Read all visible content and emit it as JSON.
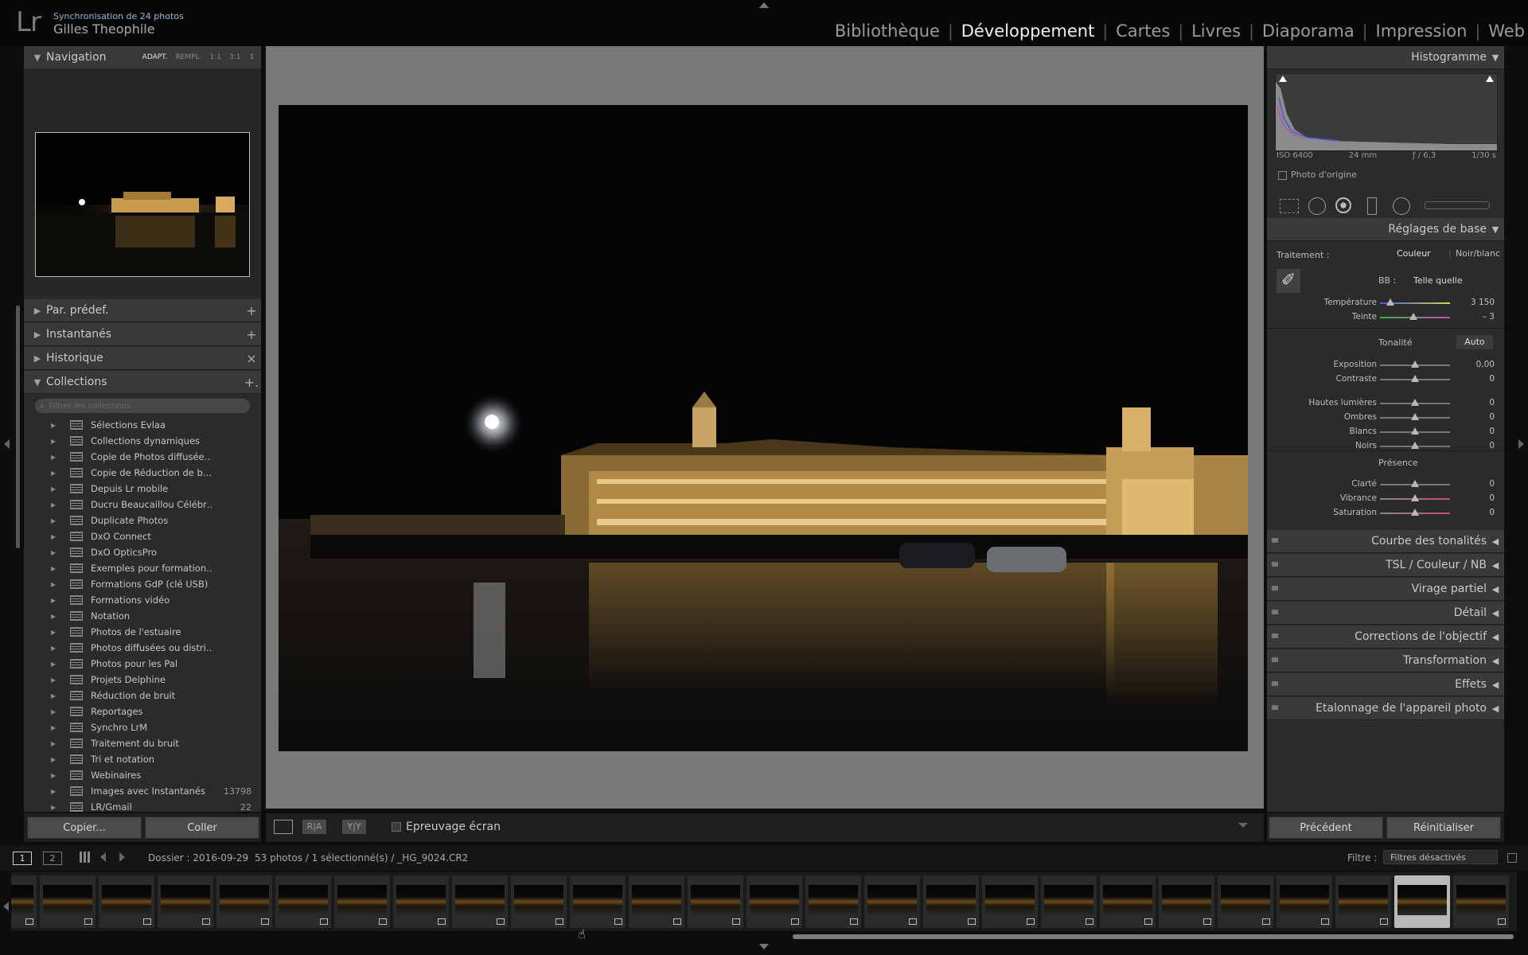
{
  "header": {
    "sync_text": "Synchronisation de 24 photos",
    "user_name": "Gilles Theophile",
    "logo": "Lr",
    "modules": [
      "Bibliothèque",
      "Développement",
      "Cartes",
      "Livres",
      "Diaporama",
      "Impression",
      "Web"
    ],
    "active_module": "Développement"
  },
  "left_panel": {
    "navigation": {
      "title": "Navigation",
      "zoom_options": [
        "ADAPT.",
        "REMPL.",
        "1:1",
        "3:1"
      ],
      "active_zoom": "ADAPT."
    },
    "sections": [
      {
        "title": "Par. prédef.",
        "action": "+"
      },
      {
        "title": "Instantanés",
        "action": "+"
      },
      {
        "title": "Historique",
        "action": "×"
      }
    ],
    "collections": {
      "title": "Collections",
      "action": "+.",
      "search_placeholder": "Filtrer les collections",
      "items": [
        {
          "label": "Sélections Evlaa",
          "count": ""
        },
        {
          "label": "Collections dynamiques",
          "count": ""
        },
        {
          "label": "Copie de Photos diffusée…",
          "count": ""
        },
        {
          "label": "Copie de Réduction de b…",
          "count": ""
        },
        {
          "label": "Depuis Lr mobile",
          "count": ""
        },
        {
          "label": "Ducru Beaucaillou Célébr…",
          "count": ""
        },
        {
          "label": "Duplicate Photos",
          "count": ""
        },
        {
          "label": "DxO Connect",
          "count": ""
        },
        {
          "label": "DxO OpticsPro",
          "count": ""
        },
        {
          "label": "Exemples pour formation…",
          "count": ""
        },
        {
          "label": "Formations GdP (clé USB)",
          "count": ""
        },
        {
          "label": "Formations vidéo",
          "count": ""
        },
        {
          "label": "Notation",
          "count": ""
        },
        {
          "label": "Photos de l'estuaire",
          "count": ""
        },
        {
          "label": "Photos diffusées ou distri…",
          "count": ""
        },
        {
          "label": "Photos pour les Pal",
          "count": ""
        },
        {
          "label": "Projets Delphine",
          "count": ""
        },
        {
          "label": "Réduction de bruit",
          "count": ""
        },
        {
          "label": "Reportages",
          "count": ""
        },
        {
          "label": "Synchro LrM",
          "count": ""
        },
        {
          "label": "Traitement du bruit",
          "count": ""
        },
        {
          "label": "Tri et notation",
          "count": ""
        },
        {
          "label": "Webinaires",
          "count": ""
        },
        {
          "label": "Images avec Instantanés",
          "count": "13798"
        },
        {
          "label": "LR/Gmail",
          "count": "22"
        }
      ]
    },
    "buttons": {
      "copy": "Copier...",
      "paste": "Coller"
    }
  },
  "center": {
    "toolbar": {
      "proof_label": "Epreuvage écran",
      "view_labels": [
        "R|A",
        "Y|Y"
      ]
    }
  },
  "right_panel": {
    "histogram": {
      "title": "Histogramme",
      "iso": "ISO 6400",
      "focal": "24 mm",
      "aperture": "ƒ / 6,3",
      "shutter": "1/30 s",
      "original_photo": "Photo d'origine"
    },
    "basic": {
      "title": "Réglages de base",
      "treatment_label": "Traitement :",
      "treatment_options": [
        "Couleur",
        "Noir/blanc"
      ],
      "wb_label": "BB :",
      "wb_value": "Telle quelle",
      "tone_label": "Tonalité",
      "auto_label": "Auto",
      "presence_label": "Présence",
      "sliders": [
        {
          "label": "Température",
          "value": "3 150",
          "pos": 0.15
        },
        {
          "label": "Teinte",
          "value": "– 3",
          "pos": 0.48
        },
        {
          "label": "Exposition",
          "value": "0,00",
          "pos": 0.5
        },
        {
          "label": "Contraste",
          "value": "0",
          "pos": 0.5
        },
        {
          "label": "Hautes lumières",
          "value": "0",
          "pos": 0.5
        },
        {
          "label": "Ombres",
          "value": "0",
          "pos": 0.5
        },
        {
          "label": "Blancs",
          "value": "0",
          "pos": 0.5
        },
        {
          "label": "Noirs",
          "value": "0",
          "pos": 0.5
        },
        {
          "label": "Clarté",
          "value": "0",
          "pos": 0.5
        },
        {
          "label": "Vibrance",
          "value": "0",
          "pos": 0.5
        },
        {
          "label": "Saturation",
          "value": "0",
          "pos": 0.5
        }
      ]
    },
    "panels": [
      "Courbe des tonalités",
      "TSL / Couleur / NB",
      "Virage partiel",
      "Détail",
      "Corrections de l'objectif",
      "Transformation",
      "Effets",
      "Etalonnage de l'appareil photo"
    ],
    "buttons": {
      "previous": "Précédent",
      "reset": "Réinitialiser"
    }
  },
  "filmstrip": {
    "page1": "1",
    "page2": "2",
    "folder": "Dossier : 2016-09-29",
    "count": "53 photos / 1 sélectionné(s) / _HG_9024.CR2",
    "filter_label": "Filtre :",
    "filter_value": "Filtres désactivés",
    "thumb_count": 26,
    "selected_index": 24
  }
}
